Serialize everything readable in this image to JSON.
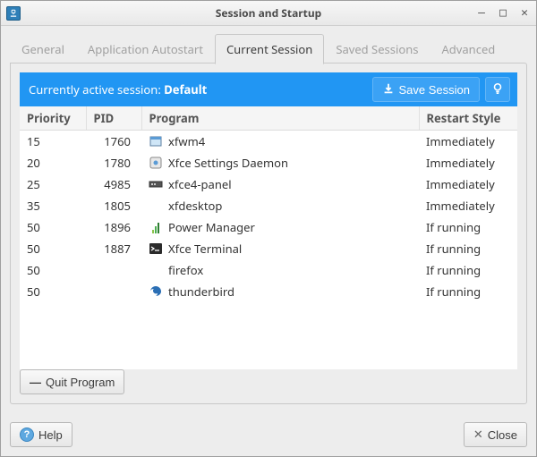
{
  "window": {
    "title": "Session and Startup"
  },
  "tabs": [
    {
      "label": "General"
    },
    {
      "label": "Application Autostart"
    },
    {
      "label": "Current Session"
    },
    {
      "label": "Saved Sessions"
    },
    {
      "label": "Advanced"
    }
  ],
  "session_banner": {
    "prefix": "Currently active session: ",
    "name": "Default",
    "save_label": "Save Session"
  },
  "table": {
    "headers": {
      "priority": "Priority",
      "pid": "PID",
      "program": "Program",
      "restart": "Restart Style"
    },
    "rows": [
      {
        "priority": "15",
        "pid": "1760",
        "program": "xfwm4",
        "icon": "window",
        "restart": "Immediately"
      },
      {
        "priority": "20",
        "pid": "1780",
        "program": "Xfce Settings Daemon",
        "icon": "settings",
        "restart": "Immediately"
      },
      {
        "priority": "25",
        "pid": "4985",
        "program": "xfce4-panel",
        "icon": "panel",
        "restart": "Immediately"
      },
      {
        "priority": "35",
        "pid": "1805",
        "program": "xfdesktop",
        "icon": "",
        "restart": "Immediately"
      },
      {
        "priority": "50",
        "pid": "1896",
        "program": "Power Manager",
        "icon": "power",
        "restart": "If running"
      },
      {
        "priority": "50",
        "pid": "1887",
        "program": "Xfce Terminal",
        "icon": "terminal",
        "restart": "If running"
      },
      {
        "priority": "50",
        "pid": "",
        "program": "firefox",
        "icon": "",
        "restart": "If running"
      },
      {
        "priority": "50",
        "pid": "",
        "program": "thunderbird",
        "icon": "tb",
        "restart": "If running"
      }
    ]
  },
  "buttons": {
    "quit": "Quit Program",
    "help": "Help",
    "close": "Close"
  }
}
